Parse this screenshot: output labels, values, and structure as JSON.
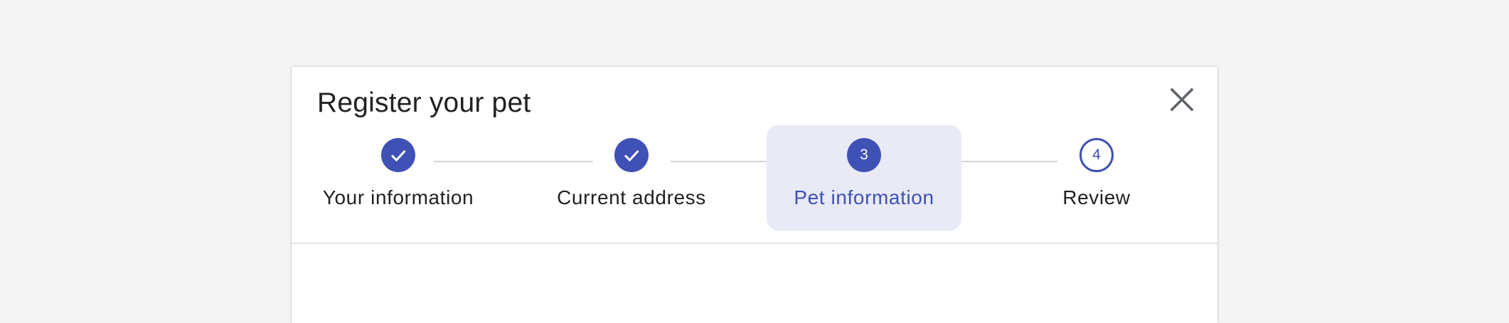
{
  "dialog": {
    "title": "Register your pet",
    "close_icon": "close-icon"
  },
  "stepper": {
    "accent_color": "#3f51b5",
    "active_background": "#e8eaf6",
    "steps": [
      {
        "label": "Your information",
        "state": "completed",
        "indicator": "check-icon"
      },
      {
        "label": "Current address",
        "state": "completed",
        "indicator": "check-icon"
      },
      {
        "label": "Pet information",
        "state": "active",
        "number": "3"
      },
      {
        "label": "Review",
        "state": "upcoming",
        "number": "4"
      }
    ]
  }
}
